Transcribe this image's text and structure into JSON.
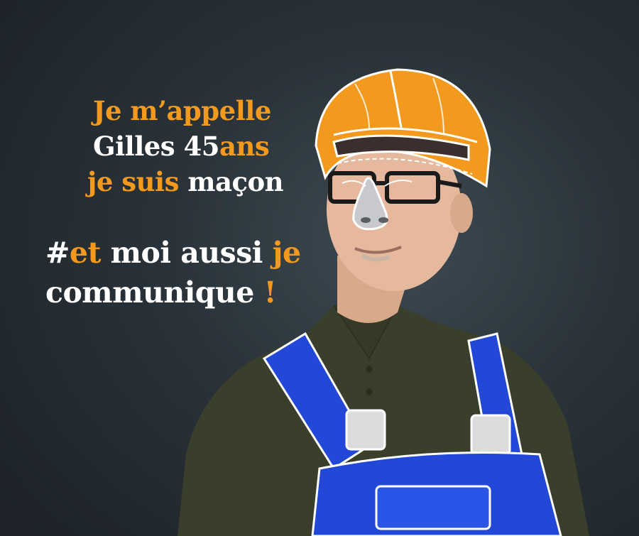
{
  "headline": {
    "line1": {
      "orange": "Je m’appelle"
    },
    "line2": {
      "white": "Gilles 45",
      "orange": "ans"
    },
    "line3": {
      "orange": "je suis",
      "white": " maçon"
    },
    "line4": {
      "white_prefix": "#",
      "orange": "et",
      "white": " moi aussi ",
      "orange2": "je"
    },
    "line5": {
      "white": "communique ",
      "orange": "!"
    }
  },
  "colors": {
    "accent": "#f39a1e",
    "background": "#2a333a",
    "overalls": "#2348d8",
    "helmet": "#f39a1e",
    "shirt": "#3a3f2c"
  },
  "illustration": {
    "subject": "smiling man wearing a sketched orange hard hat, cartoon nose, glasses and blue overalls",
    "icons": [
      "hard-hat-icon",
      "cartoon-nose-icon",
      "glasses-icon",
      "overalls-icon"
    ]
  }
}
